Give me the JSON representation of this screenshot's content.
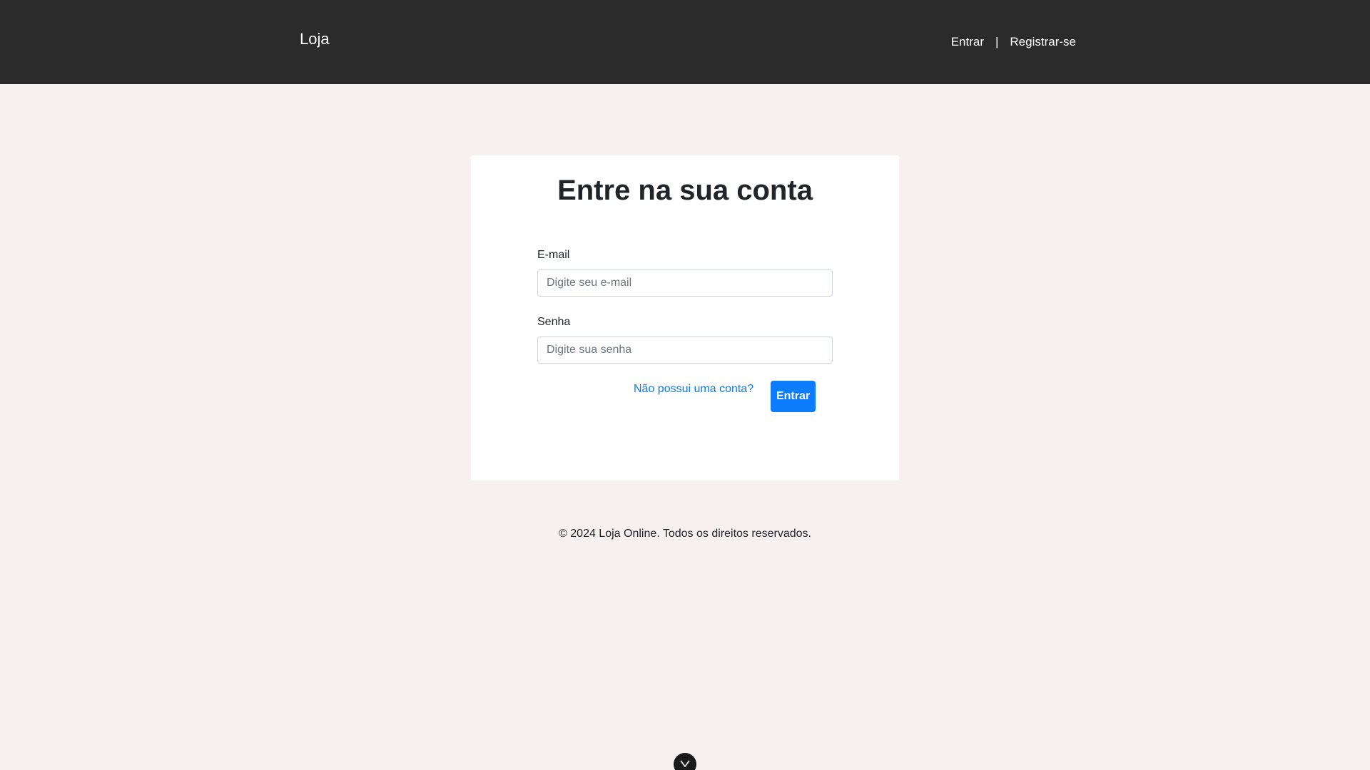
{
  "header": {
    "brand": "Loja",
    "login_link": "Entrar",
    "separator": "|",
    "register_link": "Registrar-se"
  },
  "login_form": {
    "title": "Entre na sua conta",
    "email_label": "E-mail",
    "email_placeholder": "Digite seu e-mail",
    "email_value": "",
    "password_label": "Senha",
    "password_placeholder": "Digite sua senha",
    "password_value": "",
    "no_account_link": "Não possui uma conta?",
    "submit_label": "Entrar"
  },
  "footer": {
    "text": "© 2024 Loja Online. Todos os direitos reservados."
  },
  "icons": {
    "scroll_button": "chevron-down-icon"
  },
  "colors": {
    "navbar_bg": "#2b2b2b",
    "page_bg": "#f6f0f0",
    "primary": "#0d7dfd",
    "link": "#0d7be8"
  }
}
